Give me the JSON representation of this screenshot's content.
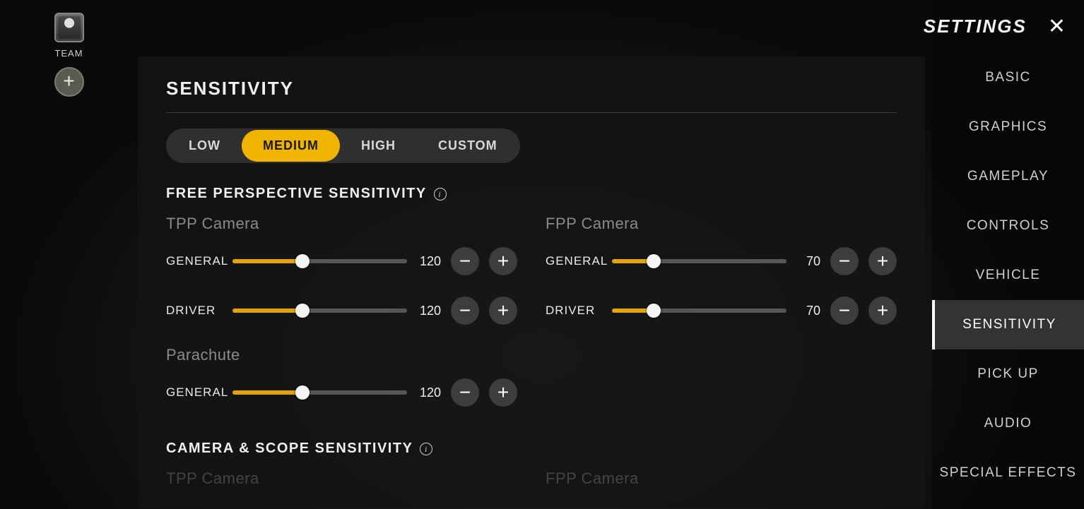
{
  "team": {
    "label": "TEAM",
    "add_symbol": "+"
  },
  "panel": {
    "title": "SENSITIVITY",
    "presets": [
      "LOW",
      "MEDIUM",
      "HIGH",
      "CUSTOM"
    ],
    "active_preset": 1,
    "section1": "FREE PERSPECTIVE SENSITIVITY",
    "section2": "CAMERA & SCOPE SENSITIVITY",
    "tpp_title": "TPP Camera",
    "fpp_title": "FPP Camera",
    "parachute_title": "Parachute",
    "labels": {
      "general": "GENERAL",
      "driver": "DRIVER"
    },
    "sliders": {
      "tpp_general": {
        "value": 120,
        "pct": 40
      },
      "tpp_driver": {
        "value": 120,
        "pct": 40
      },
      "fpp_general": {
        "value": 70,
        "pct": 24
      },
      "fpp_driver": {
        "value": 70,
        "pct": 24
      },
      "para_general": {
        "value": 120,
        "pct": 40
      }
    },
    "minus": "−",
    "plus": "+"
  },
  "nav": {
    "title": "SETTINGS",
    "items": [
      "BASIC",
      "GRAPHICS",
      "GAMEPLAY",
      "CONTROLS",
      "VEHICLE",
      "SENSITIVITY",
      "PICK UP",
      "AUDIO",
      "SPECIAL EFFECTS"
    ],
    "active": 5
  }
}
